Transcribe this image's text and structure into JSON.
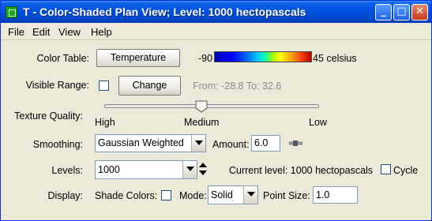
{
  "window": {
    "title": "T - Color-Shaded Plan View; Level: 1000 hectopascals",
    "buttons": {
      "minimize": "_",
      "maximize": "□",
      "close": "✕"
    }
  },
  "menu": {
    "file": "File",
    "edit": "Edit",
    "view": "View",
    "help": "Help"
  },
  "color_table": {
    "label": "Color Table:",
    "button": "Temperature",
    "range_min": "-90",
    "range_max": "45 celsius"
  },
  "visible_range": {
    "label": "Visible Range:",
    "button": "Change",
    "info": "From: -28.8 To: 32.6"
  },
  "texture_quality": {
    "label": "Texture Quality:",
    "ticks": [
      "High",
      "Medium",
      "Low"
    ],
    "selected": "Medium"
  },
  "smoothing": {
    "label": "Smoothing:",
    "value": "Gaussian Weighted",
    "amount_label": "Amount:",
    "amount_value": "6.0"
  },
  "levels": {
    "label": "Levels:",
    "value": "1000",
    "current": "Current level: 1000 hectopascals",
    "cycle_label": "Cycle"
  },
  "display": {
    "label": "Display:",
    "shade_colors_label": "Shade Colors:",
    "mode_label": "Mode:",
    "mode_value": "Solid",
    "point_size_label": "Point Size:",
    "point_size_value": "1.0"
  },
  "colors": {
    "titlebar": "#0054e3",
    "window_bg": "#ece9d8"
  },
  "icons": {
    "app": "idv-app-icon",
    "slider_thumb": "slider-thumb-icon"
  }
}
